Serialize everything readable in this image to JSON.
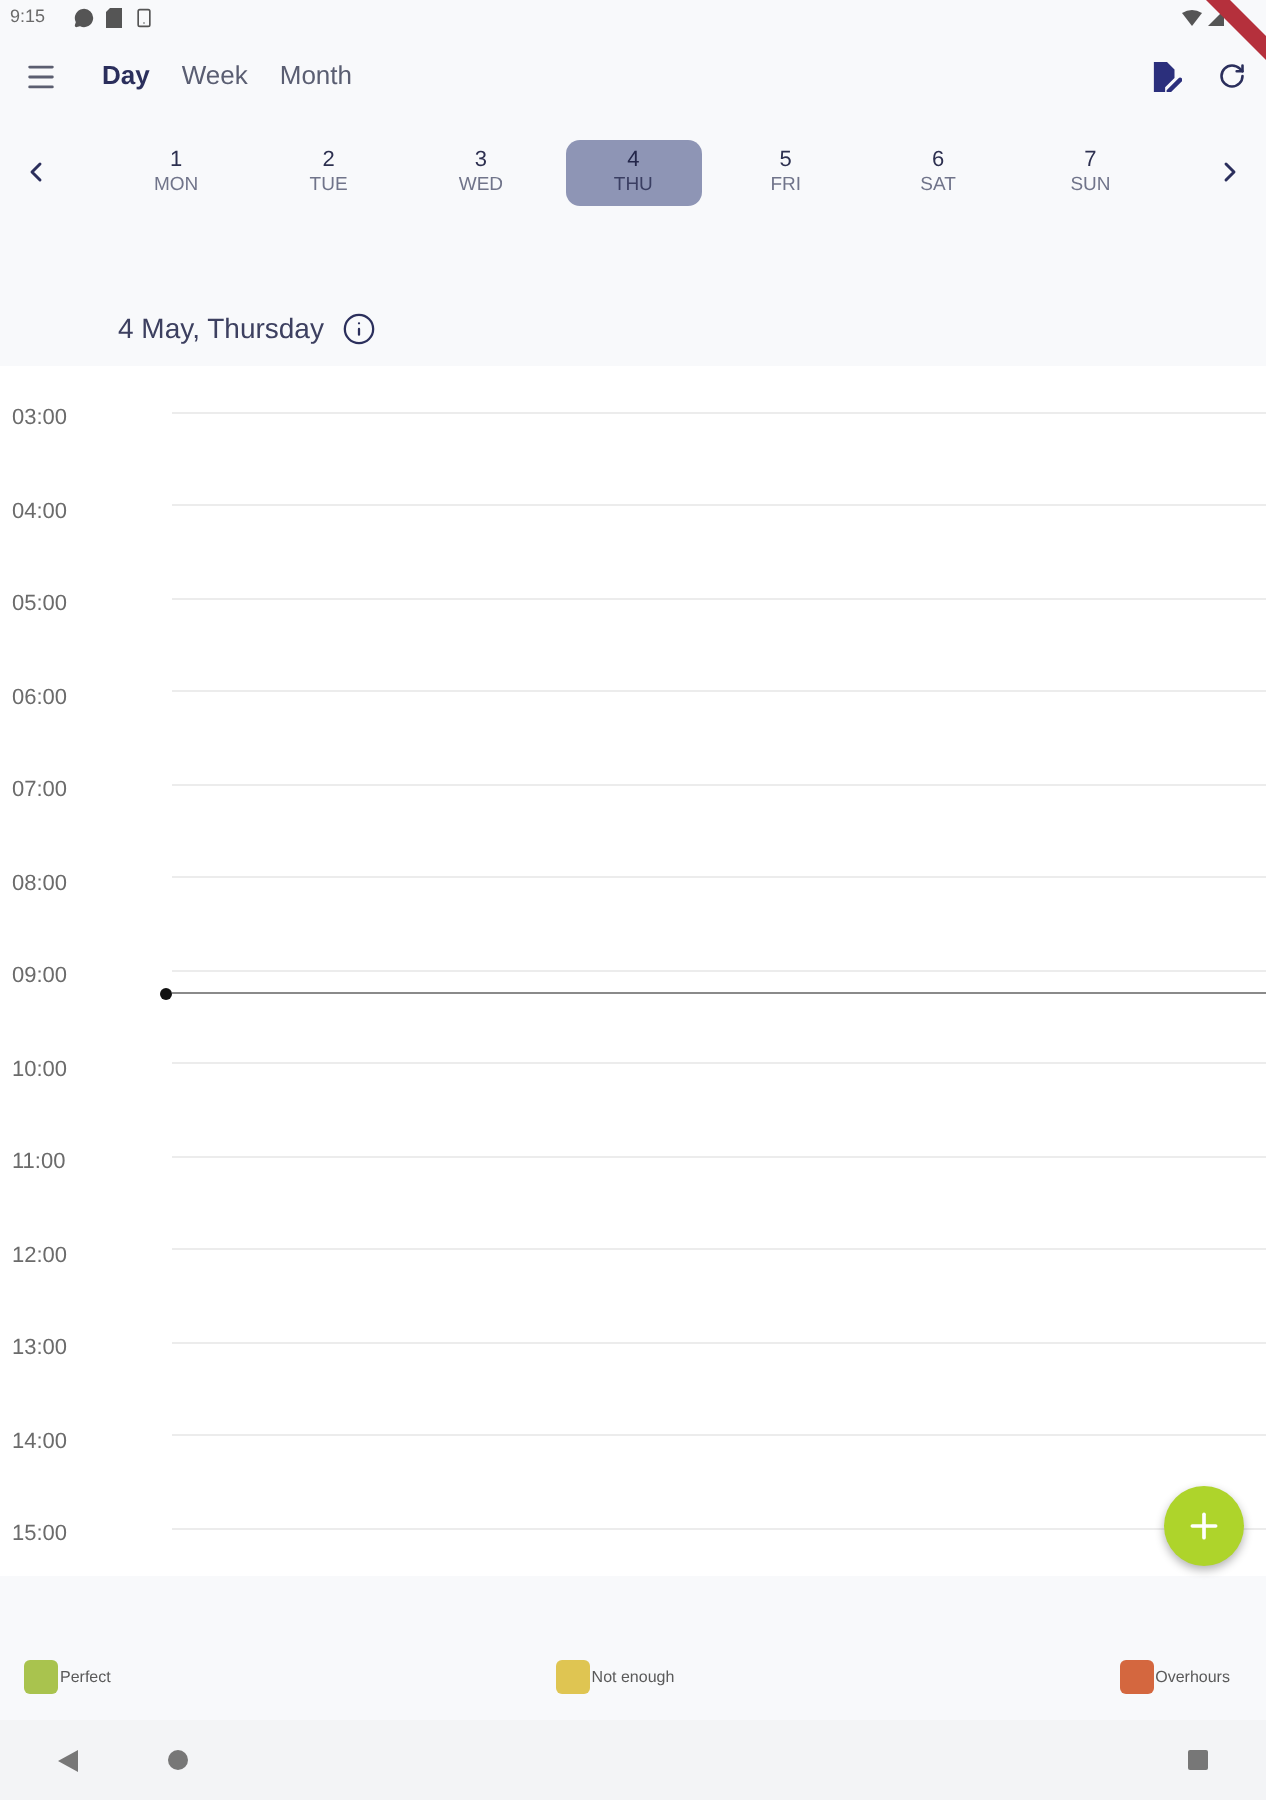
{
  "status_bar": {
    "time": "9:15"
  },
  "app_bar": {
    "tabs": [
      {
        "label": "Day",
        "selected": true
      },
      {
        "label": "Week",
        "selected": false
      },
      {
        "label": "Month",
        "selected": false
      }
    ]
  },
  "week_strip": {
    "days": [
      {
        "number": "1",
        "weekday": "MON",
        "selected": false
      },
      {
        "number": "2",
        "weekday": "TUE",
        "selected": false
      },
      {
        "number": "3",
        "weekday": "WED",
        "selected": false
      },
      {
        "number": "4",
        "weekday": "THU",
        "selected": true
      },
      {
        "number": "5",
        "weekday": "FRI",
        "selected": false
      },
      {
        "number": "6",
        "weekday": "SAT",
        "selected": false
      },
      {
        "number": "7",
        "weekday": "SUN",
        "selected": false
      }
    ]
  },
  "date_heading": {
    "text": "4 May, Thursday"
  },
  "timeline": {
    "hours": [
      {
        "label": "03:00",
        "current": false
      },
      {
        "label": "04:00",
        "current": false
      },
      {
        "label": "05:00",
        "current": false
      },
      {
        "label": "06:00",
        "current": false
      },
      {
        "label": "07:00",
        "current": false
      },
      {
        "label": "08:00",
        "current": false
      },
      {
        "label": "09:00",
        "current": true
      },
      {
        "label": "10:00",
        "current": false
      },
      {
        "label": "11:00",
        "current": false
      },
      {
        "label": "12:00",
        "current": false
      },
      {
        "label": "13:00",
        "current": false
      },
      {
        "label": "14:00",
        "current": false
      },
      {
        "label": "15:00",
        "current": false
      }
    ]
  },
  "legend": [
    {
      "label": "Perfect",
      "color": "#a9c34e"
    },
    {
      "label": "Not enough",
      "color": "#dfc552"
    },
    {
      "label": "Overhours",
      "color": "#d4673f"
    }
  ]
}
